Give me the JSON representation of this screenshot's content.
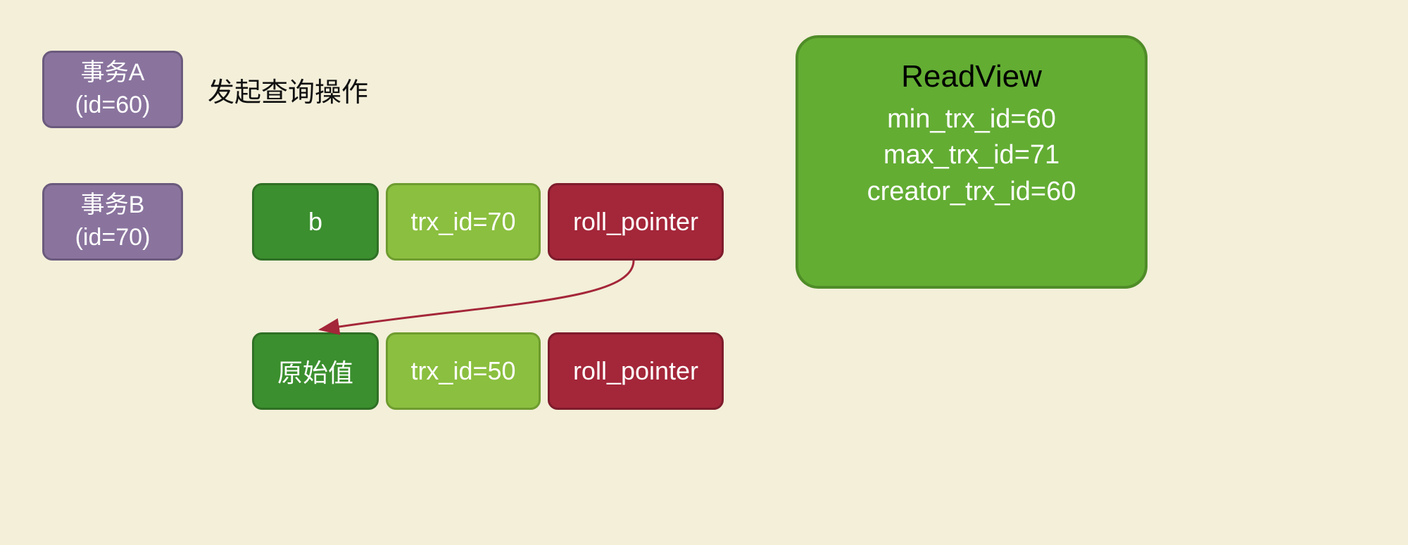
{
  "transactions": {
    "a": {
      "name": "事务A",
      "id_label": "(id=60)"
    },
    "b": {
      "name": "事务B",
      "id_label": "(id=70)"
    }
  },
  "annotation": "发起查询操作",
  "rows": {
    "current": {
      "value": "b",
      "trx": "trx_id=70",
      "ptr": "roll_pointer"
    },
    "old": {
      "value": "原始值",
      "trx": "trx_id=50",
      "ptr": "roll_pointer"
    }
  },
  "readview": {
    "title": "ReadView",
    "min": "min_trx_id=60",
    "max": "max_trx_id=71",
    "creator": "creator_trx_id=60"
  }
}
